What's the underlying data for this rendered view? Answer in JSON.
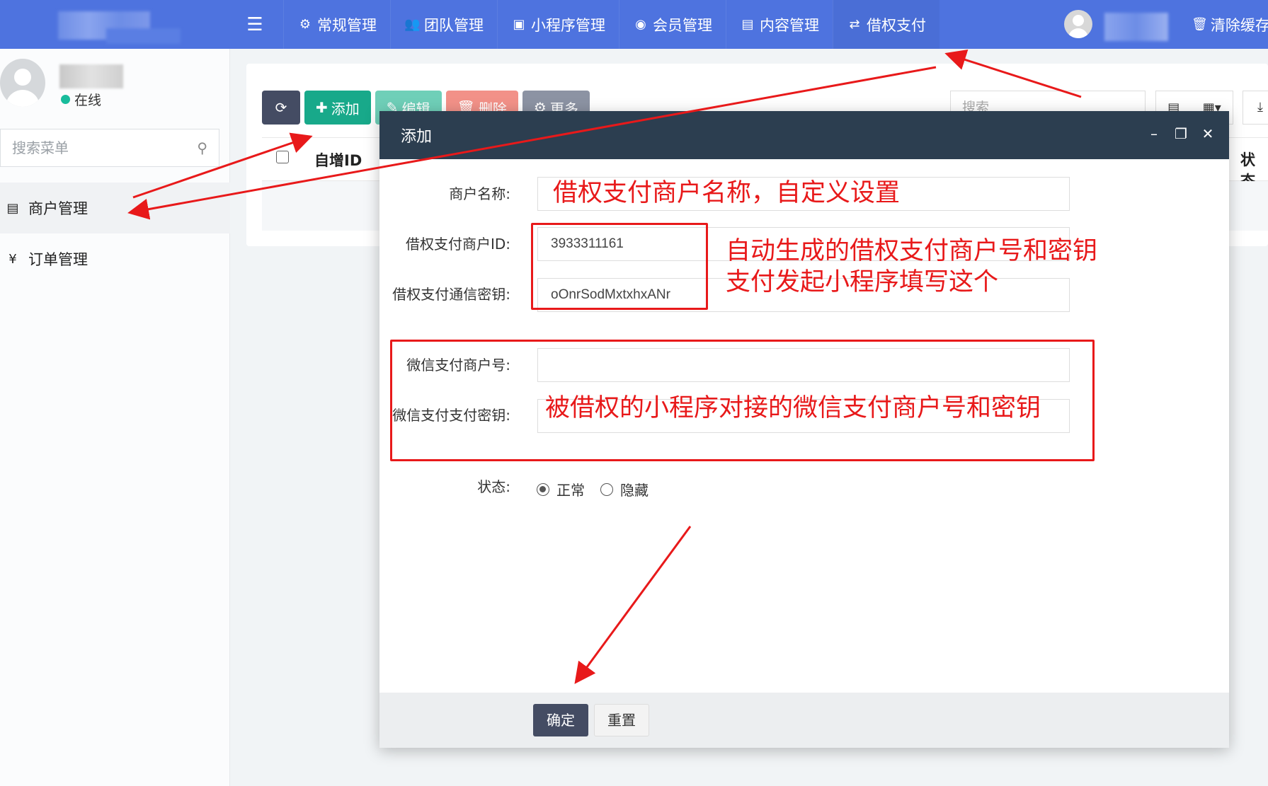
{
  "navbar": {
    "menu_items": [
      {
        "label": "常规管理",
        "icon": "cogs-icon",
        "glyph": "⚙"
      },
      {
        "label": "团队管理",
        "icon": "users-icon",
        "glyph": "👥"
      },
      {
        "label": "小程序管理",
        "icon": "miniprogram-icon",
        "glyph": "▣"
      },
      {
        "label": "会员管理",
        "icon": "user-circle-icon",
        "glyph": "◉"
      },
      {
        "label": "内容管理",
        "icon": "newspaper-icon",
        "glyph": "▤"
      },
      {
        "label": "借权支付",
        "icon": "exchange-icon",
        "glyph": "⇄"
      }
    ],
    "active_index": 5,
    "clear_cache": "清除缓存",
    "clear_cache_glyph": "🗑"
  },
  "sidebar": {
    "status": "在线",
    "search_placeholder": "搜索菜单",
    "items": [
      {
        "label": "商户管理",
        "icon": "id-card-icon",
        "glyph": "▤"
      },
      {
        "label": "订单管理",
        "icon": "yen-icon",
        "glyph": "¥"
      }
    ]
  },
  "toolbar": {
    "refresh_glyph": "⟳",
    "add": "添加",
    "edit": "编辑",
    "delete": "删除",
    "more": "更多",
    "search_placeholder": "搜索"
  },
  "table": {
    "columns": [
      "自增ID",
      "状态"
    ]
  },
  "modal": {
    "title": "添加",
    "fields": [
      {
        "label": "商户名称:",
        "value": ""
      },
      {
        "label": "借权支付商户ID:",
        "value": "3933311161"
      },
      {
        "label": "借权支付通信密钥:",
        "value": "oOnrSodMxtxhxANr"
      },
      {
        "label": "微信支付商户号:",
        "value": ""
      },
      {
        "label": "微信支付支付密钥:",
        "value": ""
      }
    ],
    "status_label": "状态:",
    "status_options": [
      "正常",
      "隐藏"
    ],
    "status_selected": "正常",
    "confirm": "确定",
    "reset": "重置"
  },
  "annotations": {
    "name_hint": "借权支付商户名称，自定义设置",
    "auto_hint_line1": "自动生成的借权支付商户号和密钥",
    "auto_hint_line2": "支付发起小程序填写这个",
    "wechat_hint": "被借权的小程序对接的微信支付商户号和密钥",
    "color": "#e8191a"
  }
}
